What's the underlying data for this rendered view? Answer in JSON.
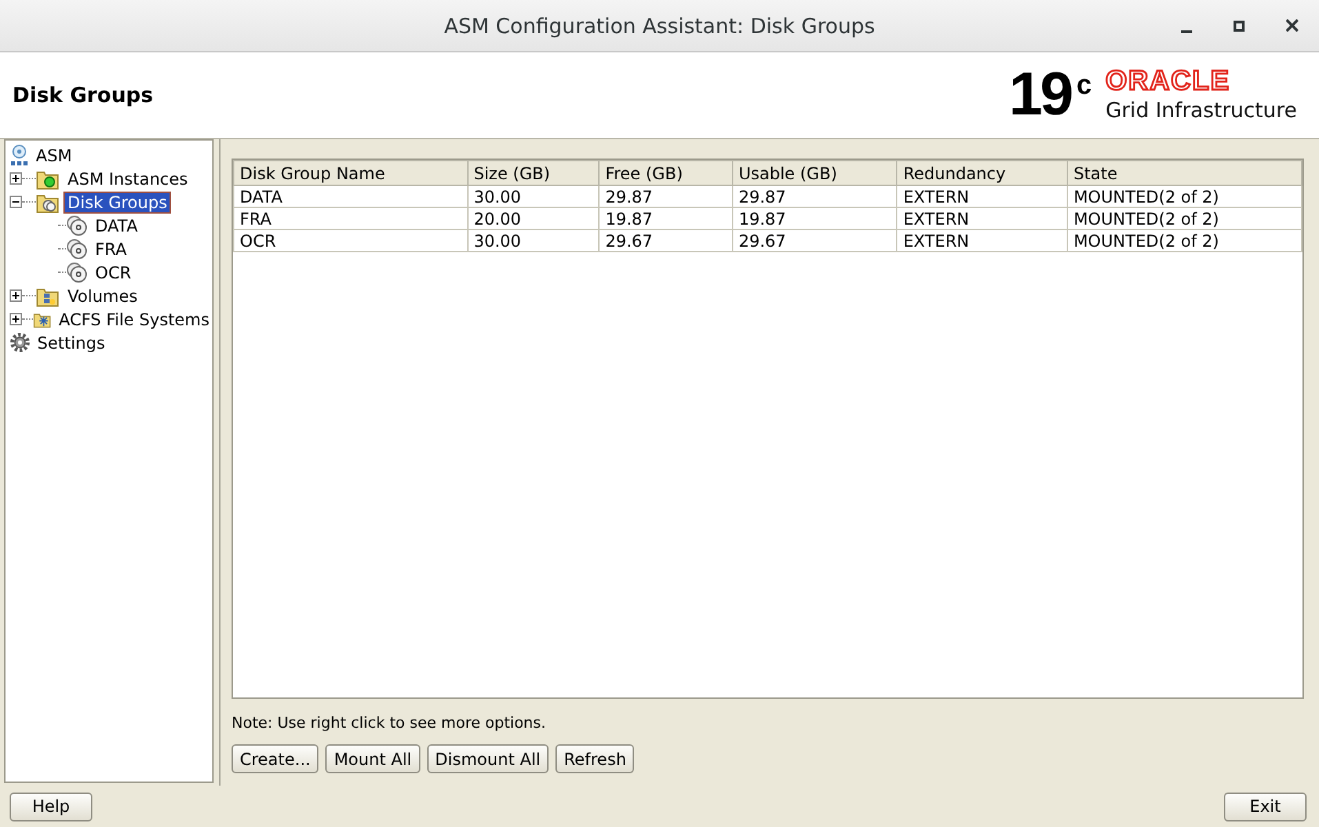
{
  "window": {
    "title": "ASM Configuration Assistant: Disk Groups"
  },
  "header": {
    "title": "Disk Groups",
    "logo": {
      "version": "19",
      "superscript": "c",
      "brand": "ORACLE",
      "product": "Grid Infrastructure"
    }
  },
  "tree": [
    {
      "label": "ASM",
      "kind": "root",
      "selected": false,
      "children": [
        {
          "label": "ASM Instances",
          "kind": "instances",
          "selected": false,
          "expanded": false,
          "has_children": true
        },
        {
          "label": "Disk Groups",
          "kind": "diskgroups",
          "selected": true,
          "expanded": true,
          "has_children": true,
          "children": [
            {
              "label": "DATA",
              "kind": "disk",
              "selected": false
            },
            {
              "label": "FRA",
              "kind": "disk",
              "selected": false
            },
            {
              "label": "OCR",
              "kind": "disk",
              "selected": false
            }
          ]
        },
        {
          "label": "Volumes",
          "kind": "volumes",
          "selected": false,
          "expanded": false,
          "has_children": true
        },
        {
          "label": "ACFS File Systems",
          "kind": "acfs",
          "selected": false,
          "expanded": false,
          "has_children": true
        }
      ]
    },
    {
      "label": "Settings",
      "kind": "settings",
      "selected": false
    }
  ],
  "table": {
    "columns": [
      "Disk Group Name",
      "Size (GB)",
      "Free (GB)",
      "Usable (GB)",
      "Redundancy",
      "State"
    ],
    "rows": [
      [
        "DATA",
        "30.00",
        "29.87",
        "29.87",
        "EXTERN",
        "MOUNTED(2 of 2)"
      ],
      [
        "FRA",
        "20.00",
        "19.87",
        "19.87",
        "EXTERN",
        "MOUNTED(2 of 2)"
      ],
      [
        "OCR",
        "30.00",
        "29.67",
        "29.67",
        "EXTERN",
        "MOUNTED(2 of 2)"
      ]
    ]
  },
  "note": "Note: Use right click to see more options.",
  "buttons": [
    "Create...",
    "Mount All",
    "Dismount All",
    "Refresh"
  ],
  "footer_buttons": [
    "Help",
    "Exit"
  ]
}
